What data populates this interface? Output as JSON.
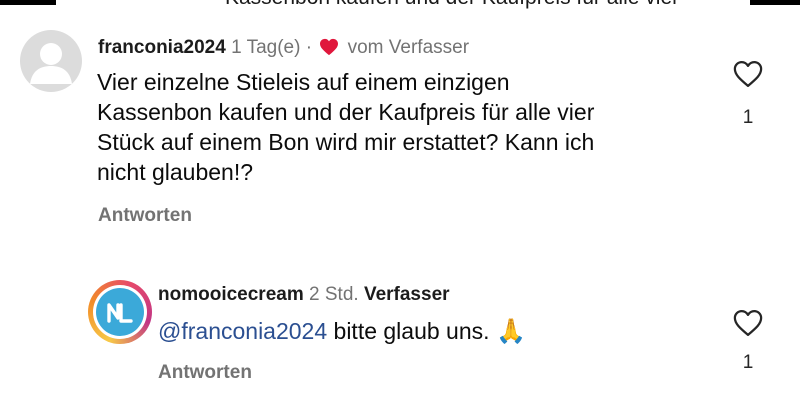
{
  "top_strip": {
    "cut_text": "Kassenbon kaufen und der Kaufpreis für alle vier"
  },
  "comment": {
    "username": "franconia2024",
    "time": "1 Tag(e)",
    "separator": "·",
    "liked_by_author_label": "vom Verfasser",
    "text_lines": [
      "Vier einzelne Stieleis auf einem einzigen",
      "Kassenbon kaufen und der Kaufpreis für alle vier",
      "Stück auf einem Bon wird mir erstattet? Kann ich",
      "nicht glauben!?"
    ],
    "reply_label": "Antworten",
    "like_count": "1",
    "avatar_icon": "default-user-icon"
  },
  "reply": {
    "username": "nomooicecream",
    "time": "2 Std.",
    "author_badge": "Verfasser",
    "mention": "@franconia2024",
    "text": " bitte glaub uns. ",
    "emoji": "🙏",
    "reply_label": "Antworten",
    "like_count": "1",
    "avatar_icon": "brand-logo-avatar"
  },
  "colors": {
    "heart_red": "#e0173c",
    "mention_blue": "#2b4f91",
    "secondary_gray": "#737373"
  }
}
